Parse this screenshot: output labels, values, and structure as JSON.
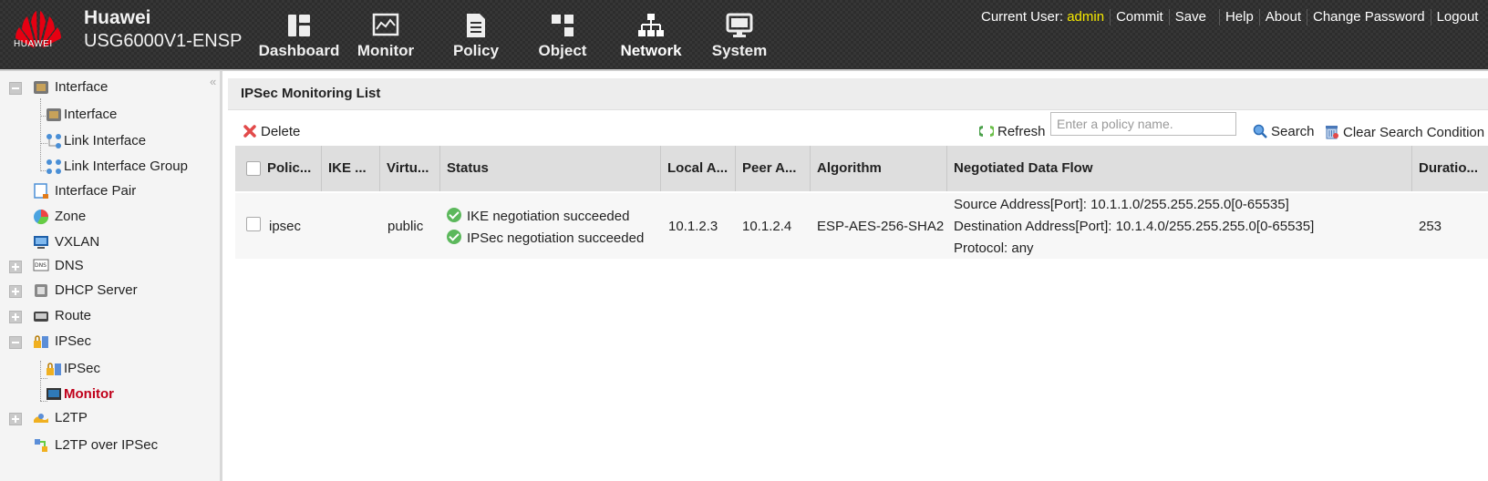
{
  "header": {
    "logo_text": "HUAWEI",
    "brand": "Huawei",
    "model": "USG6000V1-ENSP",
    "nav": [
      {
        "label": "Dashboard",
        "icon": "dashboard-icon"
      },
      {
        "label": "Monitor",
        "icon": "monitor-icon"
      },
      {
        "label": "Policy",
        "icon": "policy-icon"
      },
      {
        "label": "Object",
        "icon": "object-icon"
      },
      {
        "label": "Network",
        "icon": "network-icon",
        "active": true
      },
      {
        "label": "System",
        "icon": "system-icon"
      }
    ],
    "current_user_label": "Current User:",
    "username": "admin",
    "links": {
      "commit": "Commit",
      "save": "Save",
      "help": "Help",
      "about": "About",
      "change_password": "Change Password",
      "logout": "Logout"
    }
  },
  "sidebar": {
    "items": [
      {
        "label": "Interface",
        "expanded": true
      },
      {
        "label": "Interface"
      },
      {
        "label": "Link Interface"
      },
      {
        "label": "Link Interface Group"
      },
      {
        "label": "Interface Pair"
      },
      {
        "label": "Zone"
      },
      {
        "label": "VXLAN"
      },
      {
        "label": "DNS",
        "expanded": false
      },
      {
        "label": "DHCP Server",
        "expanded": false
      },
      {
        "label": "Route",
        "expanded": false
      },
      {
        "label": "IPSec",
        "expanded": true
      },
      {
        "label": "IPSec"
      },
      {
        "label": "Monitor",
        "selected": true
      },
      {
        "label": "L2TP",
        "expanded": false
      },
      {
        "label": "L2TP over IPSec"
      }
    ]
  },
  "main": {
    "title": "IPSec Monitoring List",
    "toolbar": {
      "delete": "Delete",
      "refresh": "Refresh",
      "search_placeholder": "Enter a policy name.",
      "search": "Search",
      "clear": "Clear Search Condition"
    },
    "columns": [
      "Polic...",
      "IKE ...",
      "Virtu...",
      "Status",
      "Local A...",
      "Peer A...",
      "Algorithm",
      "Negotiated Data Flow",
      "Duratio..."
    ],
    "rows": [
      {
        "policy": "ipsec",
        "ike": "",
        "virtual": "public",
        "status": [
          "IKE negotiation succeeded",
          "IPSec negotiation succeeded"
        ],
        "local": "10.1.2.3",
        "peer": "10.1.2.4",
        "algorithm": "ESP-AES-256-SHA2",
        "flow": [
          "Source Address[Port]: 10.1.1.0/255.255.255.0[0-65535]",
          "Destination Address[Port]: 10.1.4.0/255.255.255.0[0-65535]",
          "Protocol: any"
        ],
        "duration": "253"
      }
    ]
  },
  "colors": {
    "header_bg": "#2d2d2d",
    "username": "#f5e900",
    "selected": "#c0001a",
    "grid_head": "#dedede"
  }
}
